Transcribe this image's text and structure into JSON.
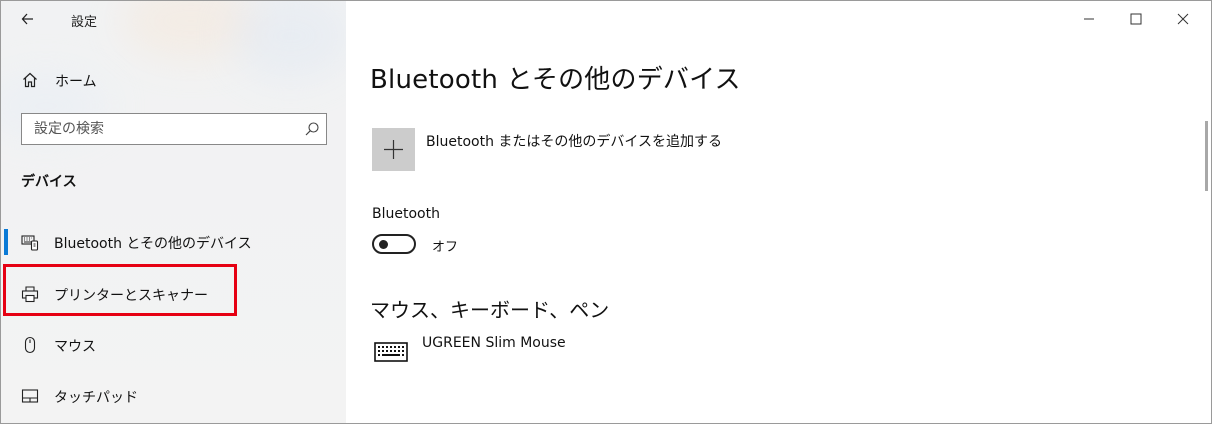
{
  "window": {
    "app_title": "設定",
    "back_icon": "back-arrow-icon",
    "controls": [
      "minimize-icon",
      "maximize-icon",
      "close-icon"
    ]
  },
  "sidebar": {
    "home_label": "ホーム",
    "home_icon": "home-icon",
    "search": {
      "placeholder": "設定の検索",
      "value": "",
      "icon": "search-icon"
    },
    "section_heading": "デバイス",
    "items": [
      {
        "label": "Bluetooth とその他のデバイス",
        "icon": "bluetooth-devices-icon",
        "selected": true
      },
      {
        "label": "プリンターとスキャナー",
        "icon": "printer-icon",
        "selected": false,
        "highlighted": true
      },
      {
        "label": "マウス",
        "icon": "mouse-icon",
        "selected": false
      },
      {
        "label": "タッチパッド",
        "icon": "touchpad-icon",
        "selected": false
      }
    ],
    "selection_color": "#0a7ad6",
    "highlight_color": "#e60012"
  },
  "main": {
    "title": "Bluetooth とその他のデバイス",
    "add_device_label": "Bluetooth またはその他のデバイスを追加する",
    "add_icon": "plus-icon",
    "bluetooth_label": "Bluetooth",
    "bluetooth_toggle_state": "オフ",
    "bluetooth_on": false,
    "mouse_section_heading": "マウス、キーボード、ペン",
    "devices": [
      {
        "name": "UGREEN Slim Mouse",
        "icon": "keyboard-icon"
      }
    ]
  }
}
